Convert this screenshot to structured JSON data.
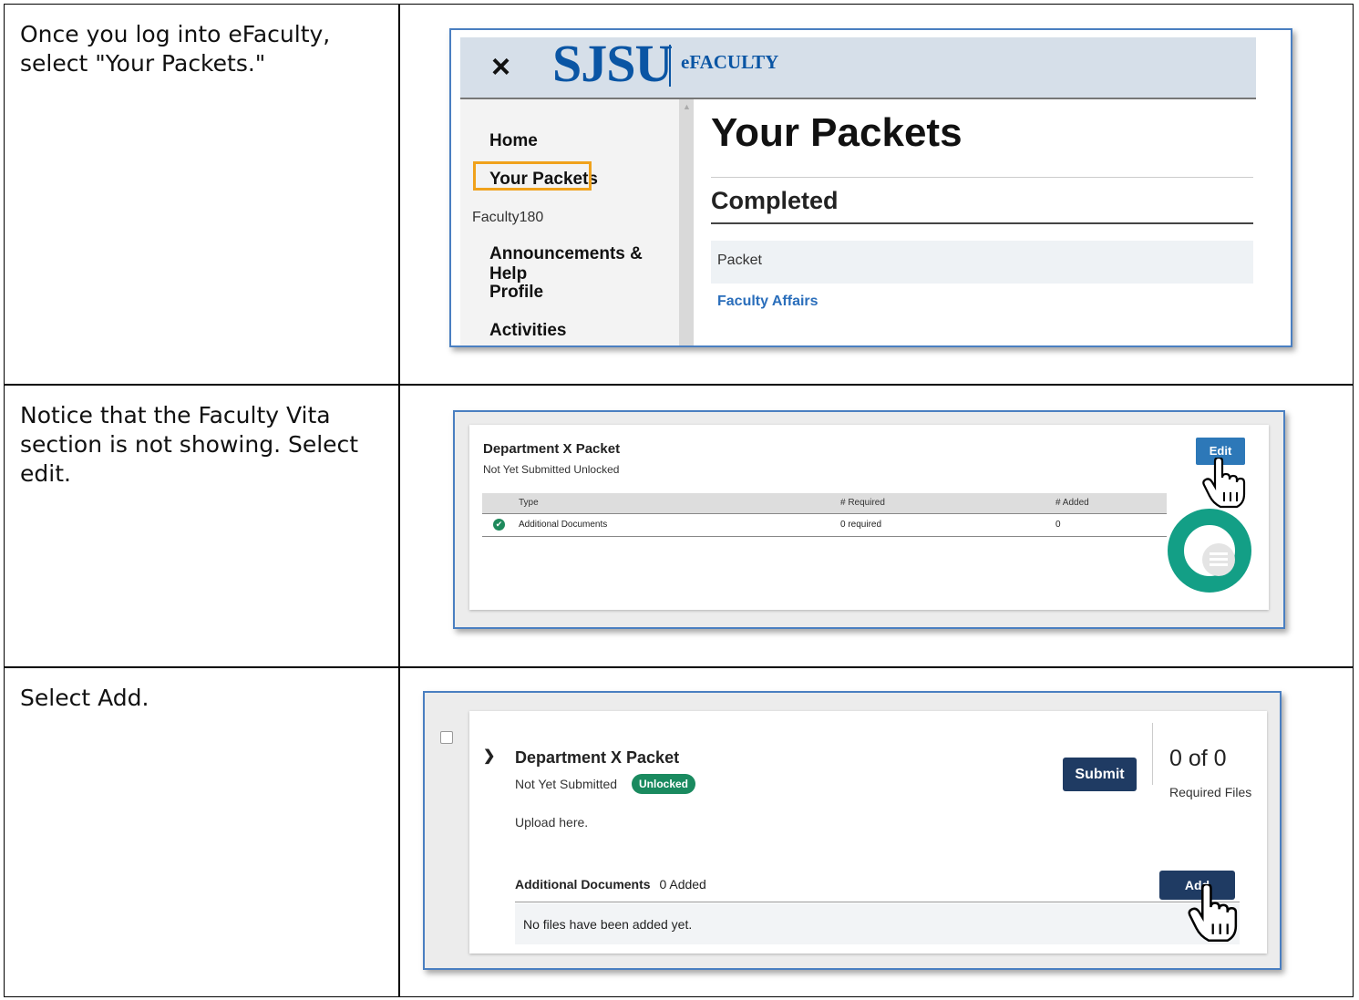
{
  "rows": [
    {
      "instruction": "Once you log into eFaculty, select \"Your Packets.\"",
      "screenshot": {
        "close_glyph": "×",
        "logo_text": "SJSU",
        "brand_text": "eFACULTY",
        "nav": {
          "home": "Home",
          "your_packets": "Your Packets",
          "section": "Faculty180",
          "announcements": "Announcements & Help",
          "profile": "Profile",
          "activities": "Activities"
        },
        "page_title": "Your Packets",
        "subheading": "Completed",
        "table_header": "Packet",
        "link": "Faculty Affairs",
        "highlight_color": "#f0a21c"
      }
    },
    {
      "instruction": "Notice that the Faculty Vita section is not showing. Select edit.",
      "screenshot": {
        "packet_title": "Department X Packet",
        "status": "Not Yet Submitted Unlocked",
        "edit_label": "Edit",
        "columns": [
          "Type",
          "# Required",
          "# Added"
        ],
        "row": {
          "type": "Additional Documents",
          "required": "0 required",
          "added": "0"
        },
        "icons": [
          "check-circle-icon",
          "pointing-hand-icon",
          "progress-donut-icon"
        ]
      }
    },
    {
      "instruction": "Select Add.",
      "screenshot": {
        "packet_title": "Department X Packet",
        "status": "Not Yet Submitted",
        "badge": "Unlocked",
        "submit_label": "Submit",
        "count": "0 of 0",
        "count_label": "Required Files",
        "upload_text": "Upload here.",
        "section_label": "Additional Documents",
        "section_count": "0 Added",
        "add_label": "Add",
        "empty_text": "No files have been added yet.",
        "icons": [
          "chevron-down-icon",
          "pointing-hand-icon"
        ]
      }
    }
  ],
  "colors": {
    "brand_blue": "#0a55a4",
    "badge_green": "#1a8a5f",
    "button_navy": "#1f3b63",
    "edit_blue": "#2d78b8",
    "donut_teal": "#139f86"
  }
}
